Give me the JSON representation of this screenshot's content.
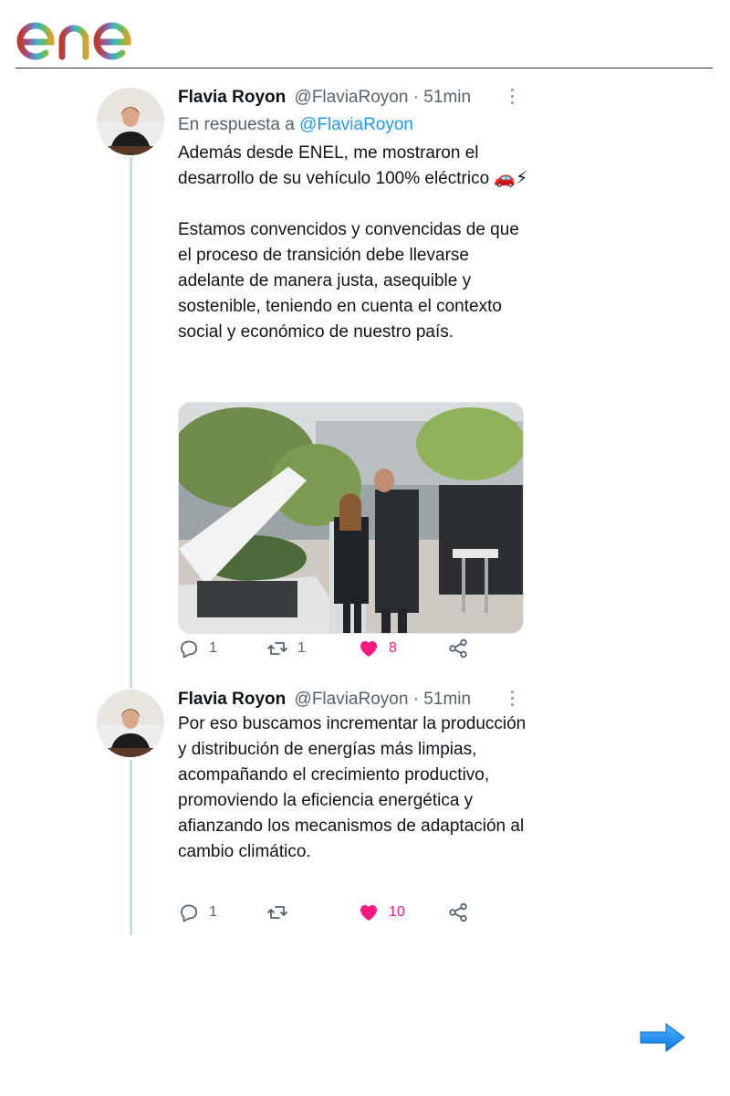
{
  "brand": {
    "logo_text": "enel",
    "colors": {
      "line": "#cfd9de",
      "like": "#f91880",
      "link": "#1d9bf0",
      "arrow": "#1e90ff"
    }
  },
  "tweets": [
    {
      "name": "Flavia Royon",
      "handle": "@FlaviaRoyon · 51min",
      "reply_prefix": "En respuesta a",
      "reply_handle": "@FlaviaRoyon",
      "text": "Además desde ENEL, me mostraron el desarrollo de su vehículo 100% eléctrico 🚗⚡\n\nEstamos convencidos y convencidas de que el proceso de transición debe llevarse adelante de manera justa, asequible y sostenible, teniendo en cuenta el contexto social y económico de nuestro país.",
      "replies": "1",
      "retweets": "1",
      "likes": "8"
    },
    {
      "name": "Flavia Royon",
      "handle": "@FlaviaRoyon · 51min",
      "text": "Por eso buscamos incrementar la producción y distribución de energías más limpias, acompañando el crecimiento productivo, promoviendo la eficiencia energética y afianzando los mecanismos de adaptación al cambio climático.",
      "replies": "1",
      "retweets": "",
      "likes": "10"
    }
  ],
  "icons": {
    "reply": "reply-icon",
    "retweet": "retweet-icon",
    "like": "heart-icon",
    "share": "share-icon",
    "menu": "more-vertical-icon",
    "next": "arrow-right-icon"
  }
}
